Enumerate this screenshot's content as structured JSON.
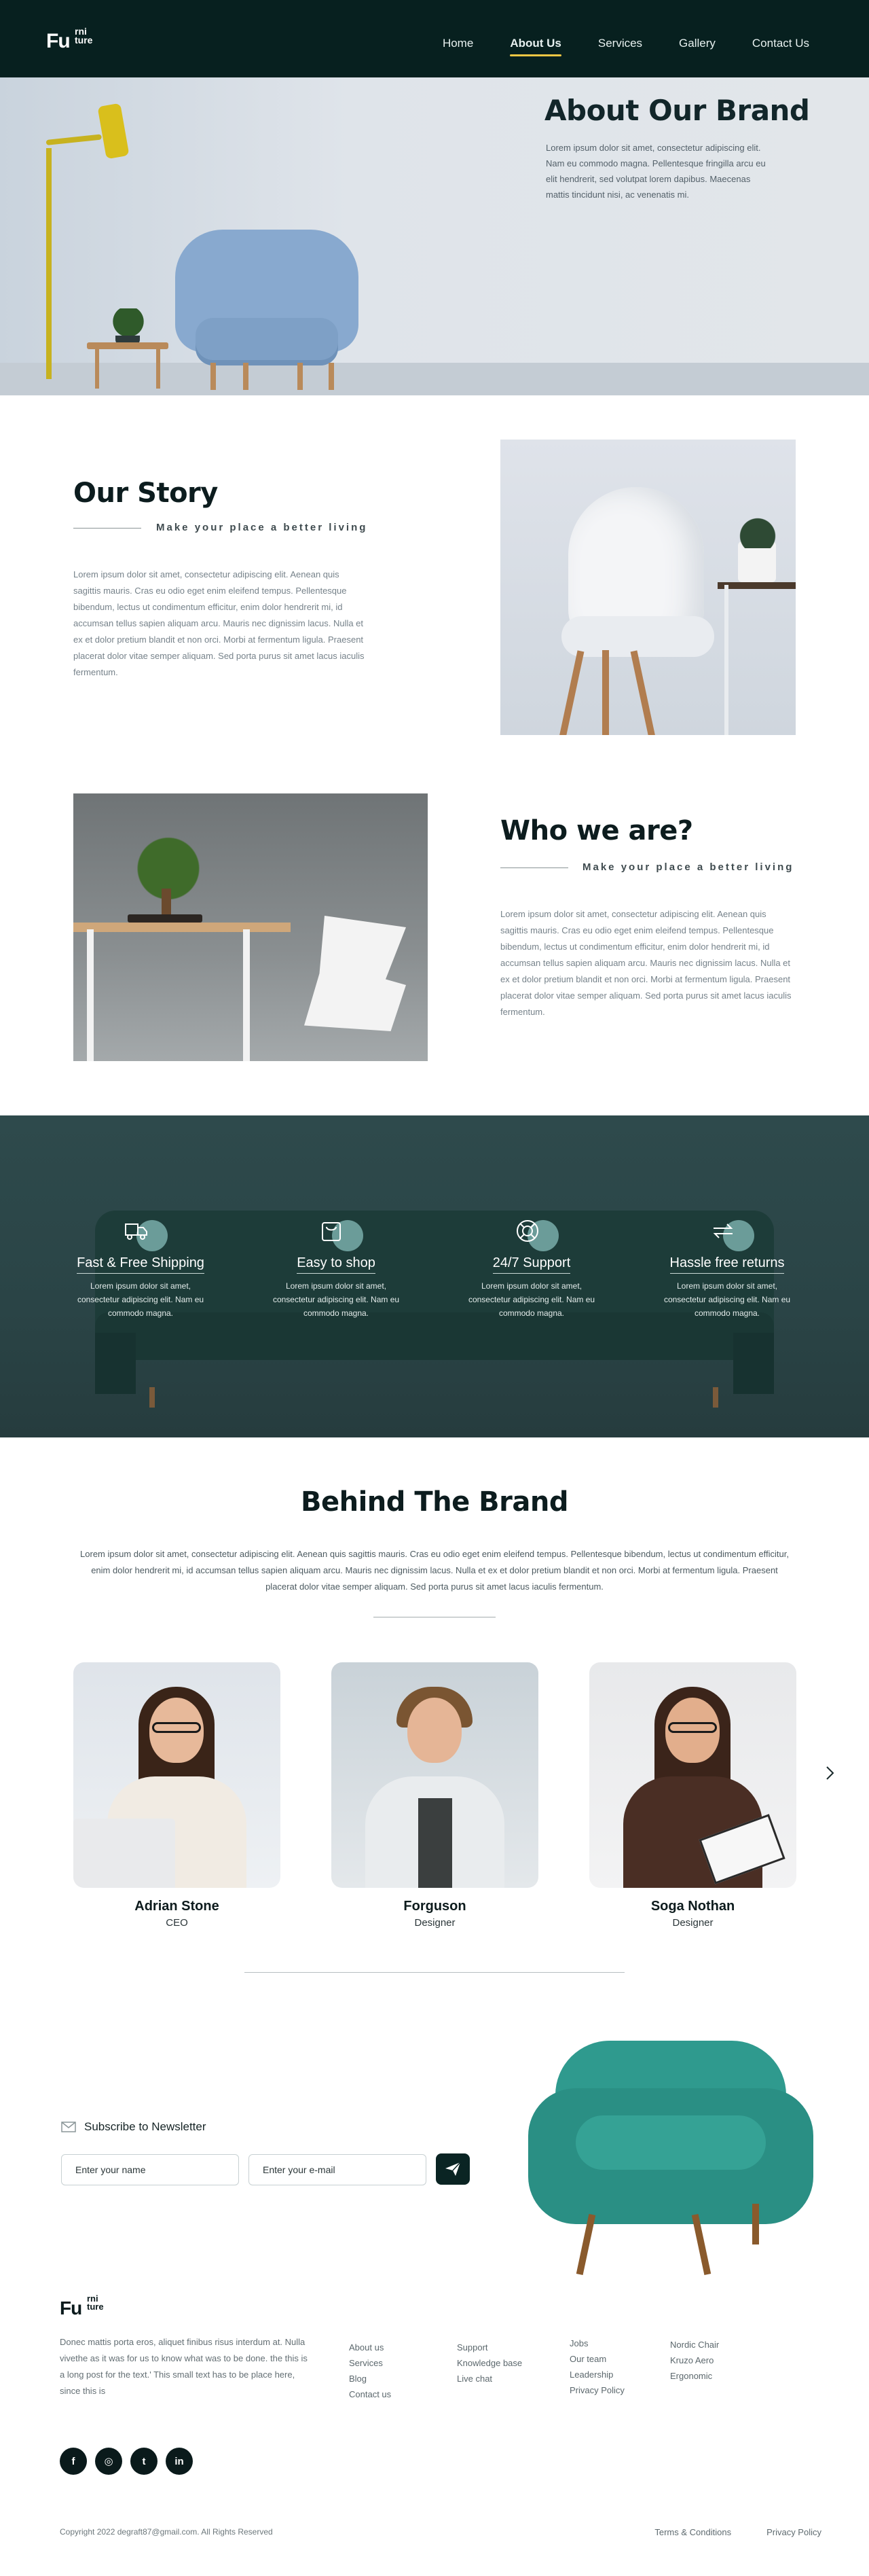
{
  "nav": {
    "logo_main": "Fu",
    "logo_sup": "rni\nture",
    "links": [
      "Home",
      "About Us",
      "Services",
      "Gallery",
      "Contact Us"
    ],
    "active": "About Us"
  },
  "hero": {
    "title": "About Our Brand",
    "text": "Lorem ipsum dolor sit amet, consectetur adipiscing elit. Nam eu commodo magna. Pellentesque fringilla arcu eu elit hendrerit, sed volutpat lorem dapibus. Maecenas mattis tincidunt nisi, ac venenatis mi."
  },
  "story": {
    "title": "Our Story",
    "tagline": "Make your place a better living",
    "text": "Lorem ipsum dolor sit amet, consectetur adipiscing elit. Aenean quis sagittis mauris. Cras eu odio eget enim eleifend tempus. Pellentesque bibendum, lectus ut condimentum efficitur, enim dolor hendrerit mi, id accumsan tellus sapien aliquam arcu. Mauris nec dignissim lacus. Nulla et ex et dolor pretium blandit et non orci. Morbi at fermentum ligula. Praesent placerat dolor vitae semper aliquam. Sed porta purus sit amet lacus iaculis fermentum."
  },
  "who": {
    "title": "Who we are?",
    "tagline": "Make your place a better living",
    "text": "Lorem ipsum dolor sit amet, consectetur adipiscing elit. Aenean quis sagittis mauris. Cras eu odio eget enim eleifend tempus. Pellentesque bibendum, lectus ut condimentum efficitur, enim dolor hendrerit mi, id accumsan tellus sapien aliquam arcu. Mauris nec dignissim lacus. Nulla et ex et dolor pretium blandit et non orci. Morbi at fermentum ligula. Praesent placerat dolor vitae semper aliquam. Sed porta purus sit amet lacus iaculis fermentum."
  },
  "features": [
    {
      "icon": "truck-icon",
      "title": "Fast  & Free Shipping",
      "text": "Lorem ipsum dolor sit amet, consectetur adipiscing elit. Nam eu commodo magna."
    },
    {
      "icon": "shopping-bag-icon",
      "title": "Easy to shop",
      "text": "Lorem ipsum dolor sit amet, consectetur adipiscing elit. Nam eu commodo magna."
    },
    {
      "icon": "support-lifebuoy-icon",
      "title": "24/7 Support",
      "text": "Lorem ipsum dolor sit amet, consectetur adipiscing elit. Nam eu commodo magna."
    },
    {
      "icon": "returns-arrows-icon",
      "title": "Hassle free returns",
      "text": "Lorem ipsum dolor sit amet, consectetur adipiscing elit. Nam eu commodo magna."
    }
  ],
  "brand": {
    "title": "Behind The Brand",
    "text": "Lorem ipsum dolor sit amet, consectetur adipiscing elit. Aenean quis sagittis mauris. Cras eu odio eget enim eleifend tempus. Pellentesque bibendum, lectus ut condimentum efficitur, enim dolor hendrerit mi, id accumsan tellus sapien aliquam arcu. Mauris nec dignissim lacus. Nulla et ex et dolor pretium blandit et non orci. Morbi at fermentum ligula. Praesent placerat dolor vitae semper aliquam. Sed porta purus sit amet lacus iaculis fermentum.",
    "team": [
      {
        "name": "Adrian Stone",
        "role": "CEO"
      },
      {
        "name": "Forguson",
        "role": "Designer"
      },
      {
        "name": "Soga Nothan",
        "role": "Designer"
      }
    ]
  },
  "newsletter": {
    "title": "Subscribe to Newsletter",
    "name_placeholder": "Enter your name",
    "email_placeholder": "Enter your e-mail"
  },
  "footer": {
    "logo_main": "Fu",
    "logo_sup": "rni\nture",
    "about": "Donec mattis porta eros, aliquet finibus risus interdum at. Nulla vivethe as it was for us to know what was to be done. the this is a long  post for the text.' This small text has to be place here, since this is",
    "col1": [
      "About us",
      "Services",
      "Blog",
      "Contact us"
    ],
    "col2": [
      "Support",
      "Knowledge base",
      "Live chat"
    ],
    "col3": [
      "Jobs",
      "Our team",
      "Leadership",
      "Privacy Policy"
    ],
    "col4": [
      "Nordic Chair",
      "Kruzo Aero",
      "Ergonomic"
    ],
    "socials": [
      "f",
      "◎",
      "t",
      "in"
    ],
    "copyright": "Copyright 2022 degraft87@gmail.com. All Rights Reserved",
    "legal": [
      "Terms & Conditions",
      "Privacy Policy"
    ]
  }
}
